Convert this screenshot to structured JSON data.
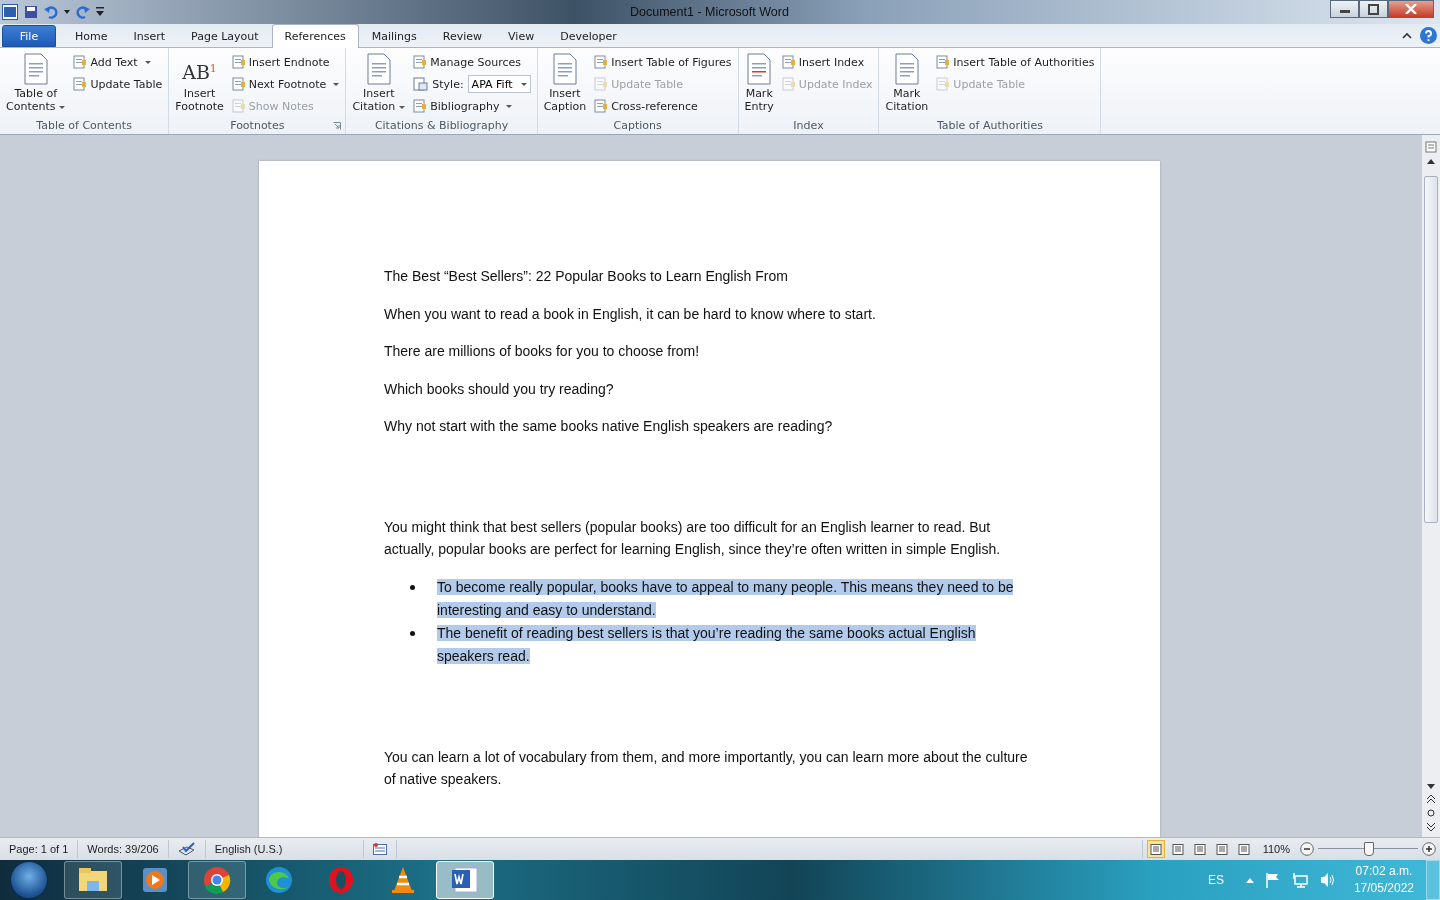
{
  "window": {
    "title": "Document1  -  Microsoft Word"
  },
  "tabs": [
    {
      "label": "File",
      "kind": "file",
      "selected": false
    },
    {
      "label": "Home",
      "kind": "tab",
      "selected": false
    },
    {
      "label": "Insert",
      "kind": "tab",
      "selected": false
    },
    {
      "label": "Page Layout",
      "kind": "tab",
      "selected": false
    },
    {
      "label": "References",
      "kind": "tab",
      "selected": true
    },
    {
      "label": "Mailings",
      "kind": "tab",
      "selected": false
    },
    {
      "label": "Review",
      "kind": "tab",
      "selected": false
    },
    {
      "label": "View",
      "kind": "tab",
      "selected": false
    },
    {
      "label": "Developer",
      "kind": "tab",
      "selected": false
    }
  ],
  "ribbon": [
    {
      "label": "Table of Contents",
      "launcher": false,
      "large": [
        {
          "label": "Table of\nContents",
          "dropdown": true,
          "disabled": false
        }
      ],
      "small": [
        {
          "label": "Add Text",
          "kind": "button",
          "dropdown": true,
          "disabled": false
        },
        {
          "label": "Update Table",
          "kind": "button",
          "dropdown": false,
          "disabled": false
        }
      ]
    },
    {
      "label": "Footnotes",
      "launcher": true,
      "large": [
        {
          "label": "Insert\nFootnote",
          "glyph": "AB$^{1}$",
          "dropdown": false,
          "disabled": false
        }
      ],
      "small": [
        {
          "label": "Insert Endnote",
          "kind": "button",
          "dropdown": false,
          "disabled": false
        },
        {
          "label": "Next Footnote",
          "kind": "button",
          "dropdown": true,
          "disabled": false
        },
        {
          "label": "Show Notes",
          "kind": "button",
          "dropdown": false,
          "disabled": true
        }
      ]
    },
    {
      "label": "Citations & Bibliography",
      "launcher": false,
      "large": [
        {
          "label": "Insert\nCitation",
          "dropdown": true,
          "disabled": false
        }
      ],
      "small": [
        {
          "label": "Manage Sources",
          "kind": "button",
          "dropdown": false,
          "disabled": false
        },
        {
          "label": "Style:",
          "kind": "combo",
          "value": "APA Fift",
          "dropdown": true,
          "disabled": false
        },
        {
          "label": "Bibliography",
          "kind": "button",
          "dropdown": true,
          "disabled": false
        }
      ]
    },
    {
      "label": "Captions",
      "launcher": false,
      "large": [
        {
          "label": "Insert\nCaption",
          "dropdown": false,
          "disabled": false
        }
      ],
      "small": [
        {
          "label": "Insert Table of Figures",
          "kind": "button",
          "dropdown": false,
          "disabled": false
        },
        {
          "label": "Update Table",
          "kind": "button",
          "dropdown": false,
          "disabled": true
        },
        {
          "label": "Cross-reference",
          "kind": "button",
          "dropdown": false,
          "disabled": false
        }
      ]
    },
    {
      "label": "Index",
      "launcher": false,
      "large": [
        {
          "label": "Mark\nEntry",
          "dropdown": false,
          "disabled": false
        }
      ],
      "small": [
        {
          "label": "Insert Index",
          "kind": "button",
          "dropdown": false,
          "disabled": false
        },
        {
          "label": "Update Index",
          "kind": "button",
          "dropdown": false,
          "disabled": true
        }
      ]
    },
    {
      "label": "Table of Authorities",
      "launcher": false,
      "large": [
        {
          "label": "Mark\nCitation",
          "dropdown": false,
          "disabled": false
        }
      ],
      "small": [
        {
          "label": "Insert Table of Authorities",
          "kind": "button",
          "dropdown": false,
          "disabled": false
        },
        {
          "label": "Update Table",
          "kind": "button",
          "dropdown": false,
          "disabled": true
        }
      ]
    }
  ],
  "document": {
    "sections": [
      [
        {
          "kind": "para",
          "text": "The Best “Best Sellers”: 22 Popular Books to Learn English From",
          "selected": false
        },
        {
          "kind": "para",
          "text": "When you want to read a book in English, it can be hard to know where to start.",
          "selected": false
        },
        {
          "kind": "para",
          "text": "There are millions of books for you to choose from!",
          "selected": false
        },
        {
          "kind": "para",
          "text": "Which books should you try reading?",
          "selected": false
        },
        {
          "kind": "para",
          "text": "Why not start with the same books native English speakers are reading?",
          "selected": false
        }
      ],
      [
        {
          "kind": "para",
          "text": "You might think that best sellers (popular books) are too difficult for an English learner to read. But actually, popular books are perfect for learning English, since they’re often written in simple English.",
          "selected": false
        },
        {
          "kind": "bullet",
          "text": "To become really popular, books have to appeal to many people. This means they need to be interesting and easy to understand.",
          "selected": true
        },
        {
          "kind": "bullet",
          "text": "The benefit of reading best sellers is that you’re reading the same books actual English speakers read.",
          "selected": true
        }
      ],
      [
        {
          "kind": "para",
          "text": "You can learn a lot of vocabulary from them, and more importantly, you can learn more about the culture of native speakers.",
          "selected": false
        }
      ]
    ]
  },
  "status_bar": {
    "left": [
      {
        "kind": "text",
        "label": "Page: 1 of 1"
      },
      {
        "kind": "text",
        "label": "Words: 39/206"
      },
      {
        "kind": "proofing"
      },
      {
        "kind": "text",
        "label": "English (U.S.)"
      },
      {
        "kind": "macro"
      }
    ],
    "views": [
      {
        "selected": true
      },
      {
        "selected": false
      },
      {
        "selected": false
      },
      {
        "selected": false
      },
      {
        "selected": false
      }
    ],
    "zoom": {
      "label": "110%",
      "level": 0.5
    }
  },
  "taskbar": {
    "apps": [
      {
        "kind": "folder",
        "running": true,
        "selected": false
      },
      {
        "kind": "media",
        "running": false,
        "selected": false
      },
      {
        "kind": "chrome",
        "running": true,
        "selected": false
      },
      {
        "kind": "edge",
        "running": false,
        "selected": false
      },
      {
        "kind": "opera",
        "running": false,
        "selected": false
      },
      {
        "kind": "vlc",
        "running": false,
        "selected": false
      },
      {
        "kind": "word",
        "running": true,
        "selected": true
      }
    ],
    "language": "ES",
    "time": "07:02 a.m.",
    "date": "17/05/2022"
  }
}
